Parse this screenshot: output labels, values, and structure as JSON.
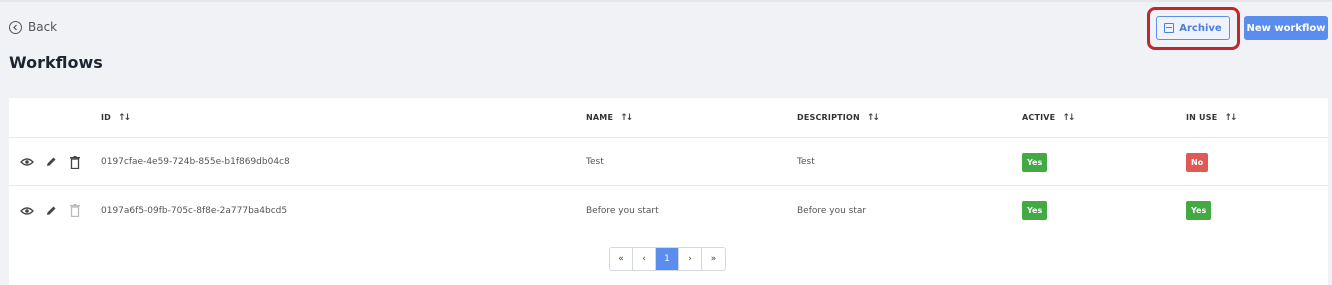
{
  "header": {
    "back_label": "Back",
    "page_title": "Workflows",
    "archive_label": "Archive",
    "new_workflow_label": "New workflow"
  },
  "icons": {
    "back": "back-circle-icon",
    "archive": "archive-icon",
    "view": "eye-icon",
    "edit": "pencil-icon",
    "delete": "trash-icon",
    "sort": "sort-icon"
  },
  "table": {
    "columns": [
      "ID",
      "NAME",
      "DESCRIPTION",
      "ACTIVE",
      "IN USE"
    ],
    "rows": [
      {
        "id": "0197cfae-4e59-724b-855e-b1f869db04c8",
        "name": "Test",
        "description": "Test",
        "active": "Yes",
        "in_use": "No"
      },
      {
        "id": "0197a6f5-09fb-705c-8f8e-2a777ba4bcd5",
        "name": "Before you start",
        "description": "Before you star",
        "active": "Yes",
        "in_use": "Yes"
      }
    ]
  },
  "pagination": {
    "first": "«",
    "prev": "‹",
    "current": "1",
    "next": "›",
    "last": "»"
  },
  "colors": {
    "primary": "#5b8def",
    "yes": "#42a943",
    "no": "#e05955",
    "highlight": "#c0272d"
  }
}
